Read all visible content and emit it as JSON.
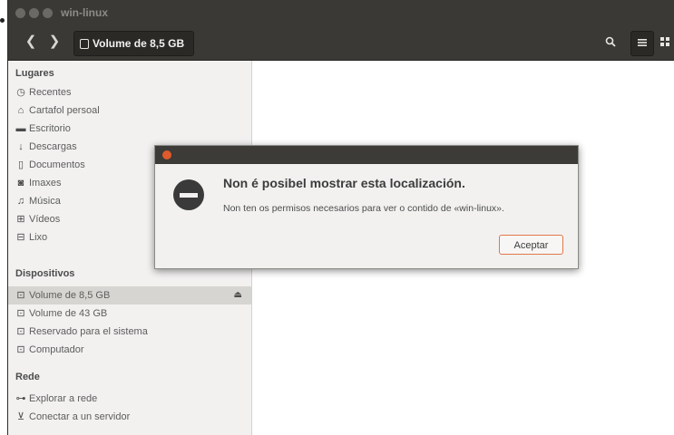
{
  "window": {
    "title": "win-linux"
  },
  "toolbar": {
    "back_icon": "chevron-left-icon",
    "forward_icon": "chevron-right-icon",
    "location_label": "Volume de 8,5 GB",
    "search_icon": "search-icon",
    "list_view_icon": "list-view-icon",
    "grid_view_icon": "grid-view-icon"
  },
  "sidebar": {
    "places_header": "Lugares",
    "places": [
      {
        "label": "Recentes",
        "icon": "clock-icon"
      },
      {
        "label": "Cartafol persoal",
        "icon": "home-icon"
      },
      {
        "label": "Escritorio",
        "icon": "desktop-folder-icon"
      },
      {
        "label": "Descargas",
        "icon": "download-icon"
      },
      {
        "label": "Documentos",
        "icon": "document-icon"
      },
      {
        "label": "Imaxes",
        "icon": "camera-icon"
      },
      {
        "label": "Música",
        "icon": "music-icon"
      },
      {
        "label": "Vídeos",
        "icon": "film-icon"
      },
      {
        "label": "Lixo",
        "icon": "trash-icon"
      }
    ],
    "devices_header": "Dispositivos",
    "devices": [
      {
        "label": "Volume de 8,5 GB",
        "icon": "drive-icon",
        "selected": true,
        "eject": true
      },
      {
        "label": "Volume de 43 GB",
        "icon": "drive-icon"
      },
      {
        "label": "Reservado para el sistema",
        "icon": "drive-icon"
      },
      {
        "label": "Computador",
        "icon": "drive-icon"
      }
    ],
    "network_header": "Rede",
    "network": [
      {
        "label": "Explorar a rede",
        "icon": "network-icon"
      },
      {
        "label": "Conectar a un servidor",
        "icon": "server-icon"
      }
    ]
  },
  "dialog": {
    "heading": "Non é posibel mostrar esta localización.",
    "message": "Non ten os permisos necesarios para ver o contido de «win-linux».",
    "accept_label": "Aceptar",
    "icon": "error-icon",
    "close_icon": "close-icon"
  }
}
